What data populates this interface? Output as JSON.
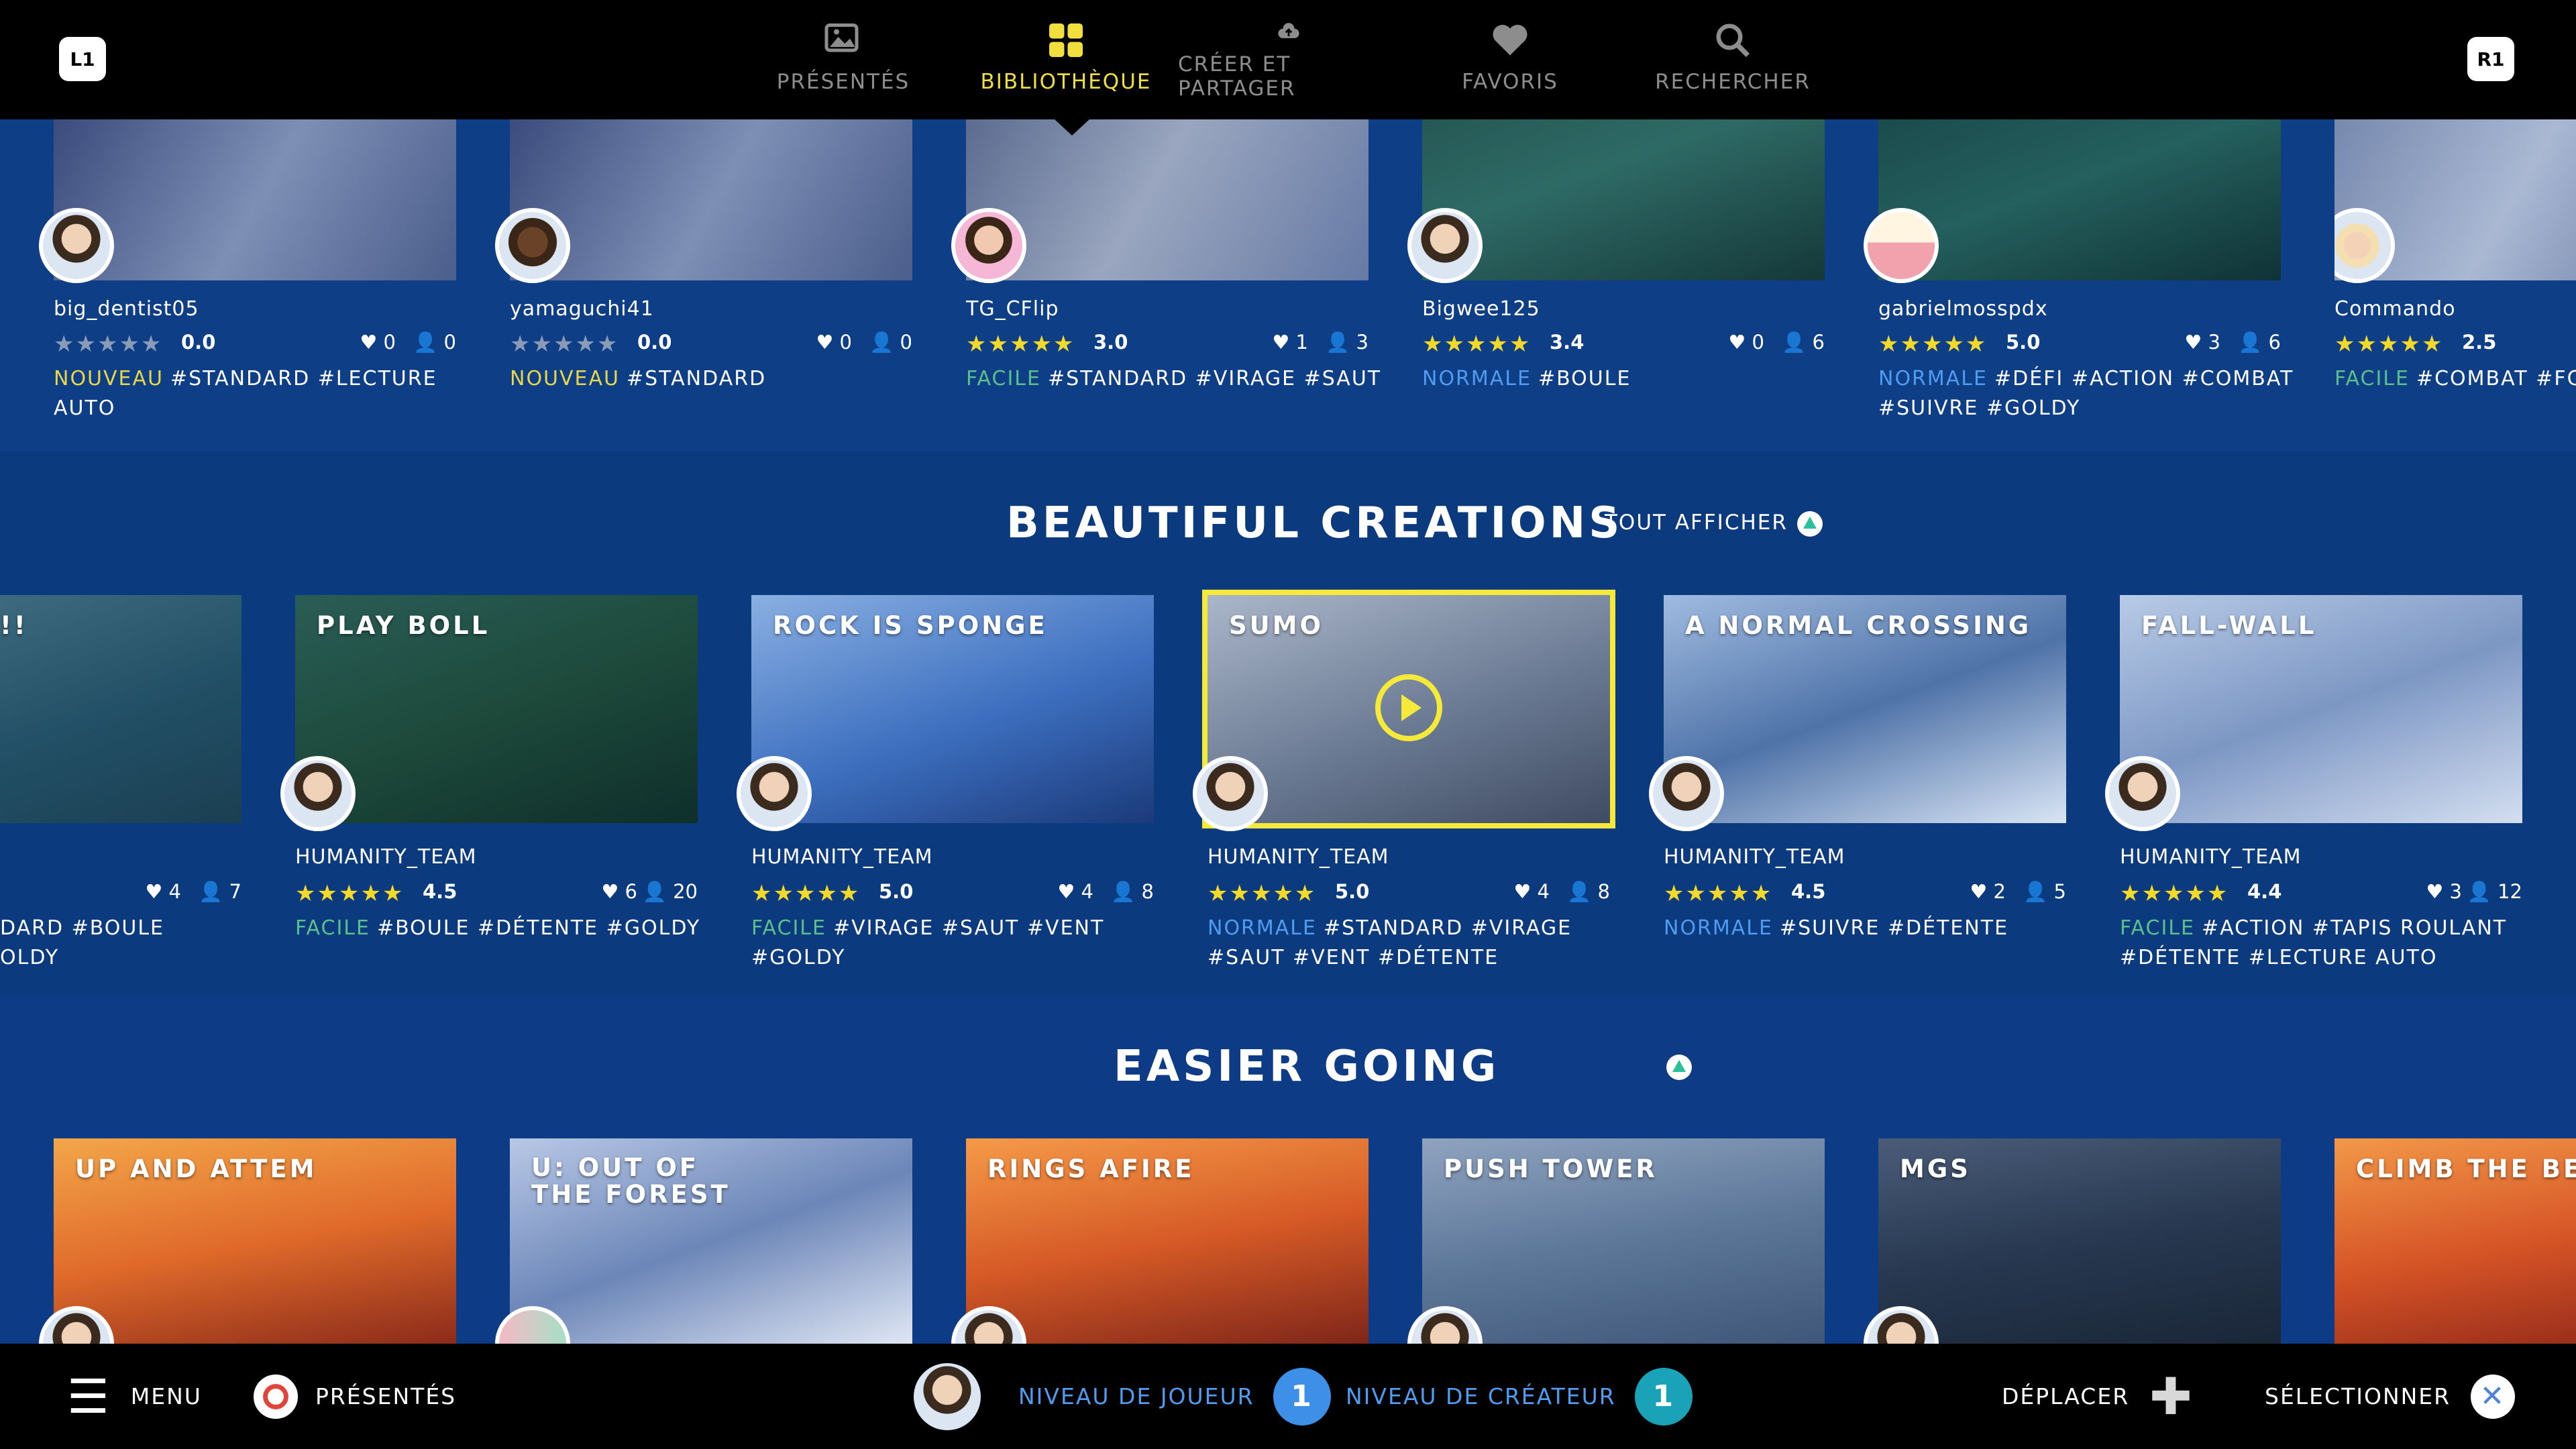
{
  "top_nav": {
    "left_shoulder": "L1",
    "right_shoulder": "R1",
    "tabs": [
      {
        "label": "PRÉSENTÉS",
        "icon": "image-icon"
      },
      {
        "label": "BIBLIOTHÈQUE",
        "icon": "grid-icon",
        "active": true
      },
      {
        "label": "CRÉER ET PARTAGER",
        "icon": "cloud-upload-icon"
      },
      {
        "label": "FAVORIS",
        "icon": "heart-icon"
      },
      {
        "label": "RECHERCHER",
        "icon": "search-icon"
      }
    ]
  },
  "row1": {
    "cards": [
      {
        "creator": "big_dentist05",
        "stars": "★★★★★",
        "stars_filled": 0,
        "rating": "0.0",
        "hearts": "0",
        "players": "0",
        "difficulty": "NOUVEAU",
        "tags": "#STANDARD #LECTURE AUTO"
      },
      {
        "creator": "yamaguchi41",
        "stars": "★★★★★",
        "stars_filled": 0,
        "rating": "0.0",
        "hearts": "0",
        "players": "0",
        "difficulty": "NOUVEAU",
        "tags": "#STANDARD"
      },
      {
        "creator": "TG_CFlip",
        "stars": "★★★★★",
        "stars_filled": 3,
        "rating": "3.0",
        "hearts": "1",
        "players": "3",
        "difficulty": "FACILE",
        "tags": "#STANDARD #VIRAGE #SAUT"
      },
      {
        "creator": "Bigwee125",
        "stars": "★★★★★",
        "stars_filled": 3.5,
        "rating": "3.4",
        "hearts": "0",
        "players": "6",
        "difficulty": "NORMALE",
        "tags": "#BOULE"
      },
      {
        "creator": "gabrielmosspdx",
        "stars": "★★★★★",
        "stars_filled": 5,
        "rating": "5.0",
        "hearts": "3",
        "players": "6",
        "difficulty": "NORMALE",
        "tags": "#DÉFI #ACTION #COMBAT #SUIVRE #GOLDY"
      },
      {
        "creator": "Commando",
        "stars": "★★★★★",
        "stars_filled": 2.5,
        "rating": "2.5",
        "hearts": "",
        "players": "",
        "difficulty": "FACILE",
        "tags": "#COMBAT #FC #GOLDY"
      }
    ]
  },
  "section2": {
    "title": "BEAUTIFUL CREATIONS",
    "see_all": "TOUT AFFICHER",
    "partial_card": {
      "title": "!!",
      "hearts": "4",
      "players": "7",
      "tags": "DARD #BOULE OLDY"
    },
    "cards": [
      {
        "title": "PLAY BOLL",
        "creator": "HUMANITY_TEAM",
        "stars": "★★★★★",
        "rating": "4.5",
        "hearts": "6",
        "players": "20",
        "difficulty": "FACILE",
        "tags": "#BOULE #DÉTENTE #GOLDY"
      },
      {
        "title": "ROCK IS SPONGE",
        "creator": "HUMANITY_TEAM",
        "stars": "★★★★★",
        "rating": "5.0",
        "hearts": "4",
        "players": "8",
        "difficulty": "FACILE",
        "tags": "#VIRAGE #SAUT #VENT #GOLDY"
      },
      {
        "title": "SUMO",
        "creator": "HUMANITY_TEAM",
        "stars": "★★★★★",
        "rating": "5.0",
        "hearts": "4",
        "players": "8",
        "difficulty": "NORMALE",
        "tags": "#STANDARD #VIRAGE #SAUT #VENT #DÉTENTE",
        "selected": true
      },
      {
        "title": "A NORMAL CROSSING",
        "creator": "HUMANITY_TEAM",
        "stars": "★★★★★",
        "rating": "4.5",
        "hearts": "2",
        "players": "5",
        "difficulty": "NORMALE",
        "tags": "#SUIVRE #DÉTENTE"
      },
      {
        "title": "FALL-WALL",
        "creator": "HUMANITY_TEAM",
        "stars": "★★★★★",
        "rating": "4.4",
        "hearts": "3",
        "players": "12",
        "difficulty": "FACILE",
        "tags": "#ACTION #TAPIS ROULANT #DÉTENTE #LECTURE AUTO"
      }
    ]
  },
  "section3": {
    "title": "EASIER GOING",
    "cards": [
      {
        "title": "UP AND ATTEM"
      },
      {
        "title": "U: OUT OF THE FOREST"
      },
      {
        "title": "RINGS AFIRE"
      },
      {
        "title": "PUSH TOWER"
      },
      {
        "title": "MGS"
      },
      {
        "title": "CLIMB THE BEAS"
      }
    ]
  },
  "bottom_bar": {
    "menu": "MENU",
    "featured": "PRÉSENTÉS",
    "player_level_label": "NIVEAU DE JOUEUR",
    "player_level": "1",
    "creator_level_label": "NIVEAU DE CRÉATEUR",
    "creator_level": "1",
    "move": "DÉPLACER",
    "select": "SÉLECTIONNER"
  },
  "colors": {
    "accent": "#f0df3c",
    "background": "#0b3b85",
    "easy": "#5bc08b",
    "normal": "#4f9cf0",
    "new": "#e9d74a"
  }
}
